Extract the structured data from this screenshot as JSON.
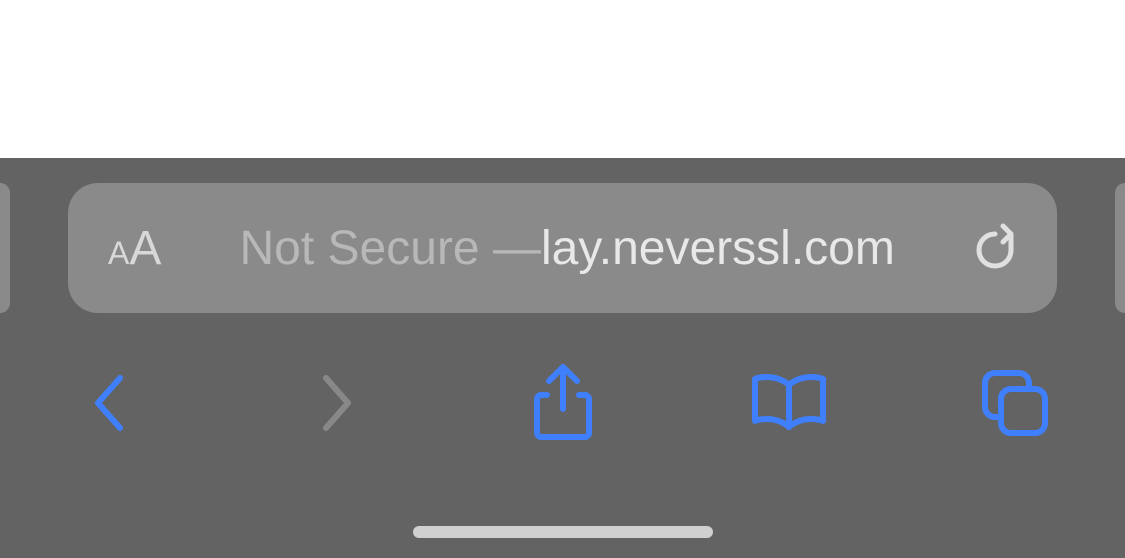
{
  "address_bar": {
    "text_size_small": "A",
    "text_size_large": "A",
    "security_label": "Not Secure — ",
    "url_fragment": "lay.neverssl.com"
  },
  "colors": {
    "chrome_bg": "#636363",
    "address_bg": "#8a8a8a",
    "active_tint": "#3f7ffc",
    "inactive_tint": "#909090",
    "text_light": "#e8e8e8",
    "text_muted": "#b8b8b8"
  }
}
